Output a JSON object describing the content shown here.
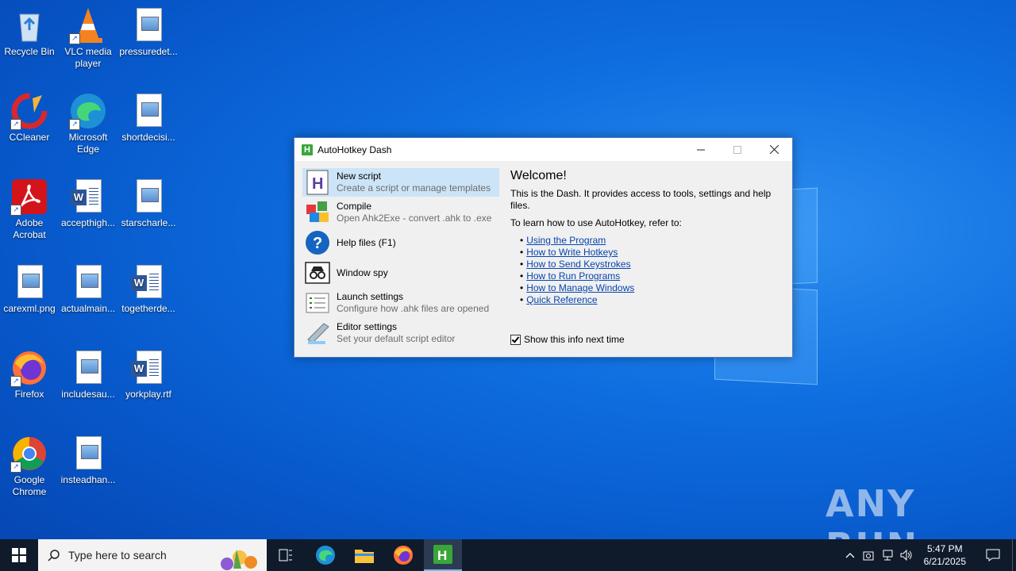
{
  "desktop": {
    "icons": [
      {
        "label": "Recycle Bin"
      },
      {
        "label": "VLC media player"
      },
      {
        "label": "pressuredet..."
      },
      {
        "label": "CCleaner"
      },
      {
        "label": "Microsoft Edge"
      },
      {
        "label": "shortdecisi..."
      },
      {
        "label": "Adobe Acrobat"
      },
      {
        "label": "accepthigh..."
      },
      {
        "label": "starscharle..."
      },
      {
        "label": "carexml.png"
      },
      {
        "label": "actualmain..."
      },
      {
        "label": "togetherde..."
      },
      {
        "label": "Firefox"
      },
      {
        "label": "includesau..."
      },
      {
        "label": "yorkplay.rtf"
      },
      {
        "label": "Google Chrome"
      },
      {
        "label": "insteadhan..."
      }
    ]
  },
  "window": {
    "title": "AutoHotkey Dash",
    "items": [
      {
        "title": "New script",
        "subtitle": "Create a script or manage templates"
      },
      {
        "title": "Compile",
        "subtitle": "Open Ahk2Exe - convert .ahk to .exe"
      },
      {
        "title": "Help files (F1)",
        "subtitle": ""
      },
      {
        "title": "Window spy",
        "subtitle": ""
      },
      {
        "title": "Launch settings",
        "subtitle": "Configure how .ahk files are opened"
      },
      {
        "title": "Editor settings",
        "subtitle": "Set your default script editor"
      }
    ],
    "welcome_heading": "Welcome!",
    "intro": "This is the Dash. It provides access to tools, settings and help files.",
    "learn": "To learn how to use AutoHotkey, refer to:",
    "links": [
      "Using the Program",
      "How to Write Hotkeys",
      "How to Send Keystrokes",
      "How to Run Programs",
      "How to Manage Windows",
      "Quick Reference"
    ],
    "show_info_label": "Show this info next time",
    "show_info_checked": true
  },
  "watermark": "ANY RUN",
  "taskbar": {
    "search_placeholder": "Type here to search",
    "time": "5:47 PM",
    "date": "6/21/2025"
  },
  "colors": {
    "link": "#0645ad",
    "selection": "#cce4f7",
    "taskbar": "#0f1a2b"
  }
}
